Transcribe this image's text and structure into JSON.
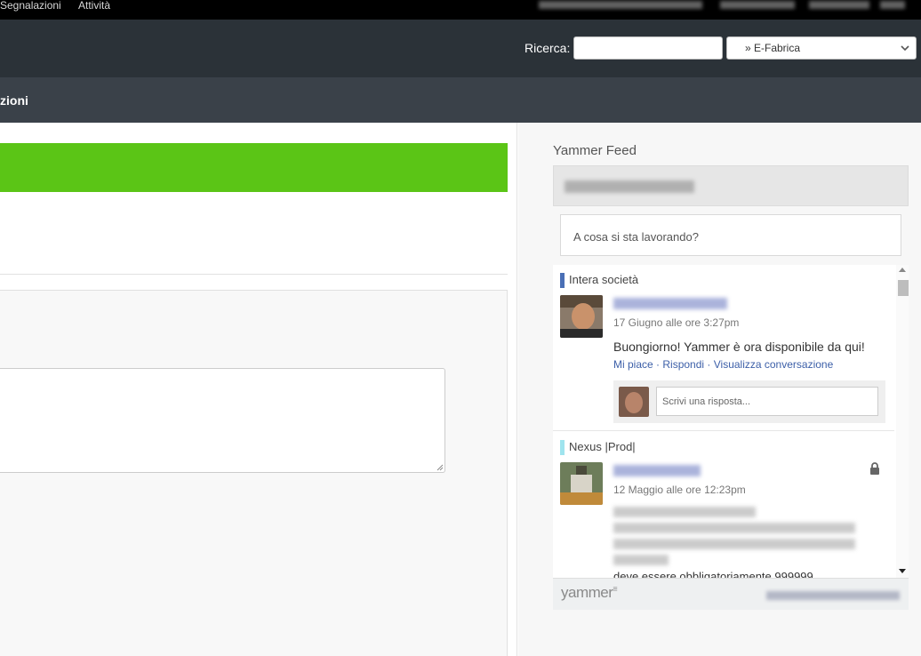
{
  "topbar": {
    "nav": [
      "Segnalazioni",
      "Attività"
    ]
  },
  "header": {
    "search_label": "Ricerca:",
    "search_value": "",
    "site_selected": "» E-Fabrica"
  },
  "navbar": {
    "title": "zioni"
  },
  "yammer": {
    "title": "Yammer Feed",
    "status_placeholder": "A cosa si sta lavorando?",
    "posts": [
      {
        "group": "Intera società",
        "group_color": "#4a6fb5",
        "timestamp": "17 Giugno alle ore 3:27pm",
        "message": "Buongiorno! Yammer è ora disponibile da qui!",
        "actions": [
          "Mi piace",
          "Rispondi",
          "Visualizza conversazione"
        ],
        "reply_placeholder": "Scrivi una risposta..."
      },
      {
        "group": "Nexus |Prod|",
        "group_color": "#9fe4ee",
        "timestamp": "12 Maggio alle ore 12:23pm",
        "message_tail": "deve essere obbligatoriamente 999999",
        "locked": true
      }
    ],
    "footer_logo": "yammer"
  },
  "icons": {
    "lock": "lock-icon",
    "select_chevron": "chevron-down-icon"
  }
}
